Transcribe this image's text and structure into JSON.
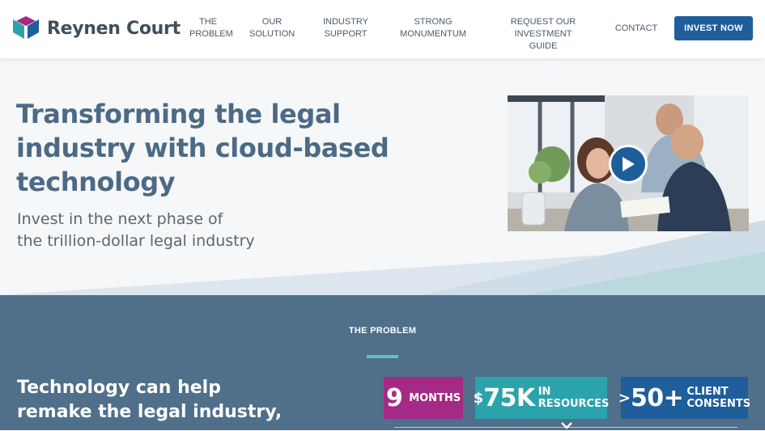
{
  "brand": {
    "name": "Reynen Court"
  },
  "nav": {
    "items": [
      {
        "line1": "The",
        "line2": "Problem"
      },
      {
        "line1": "Our",
        "line2": "Solution"
      },
      {
        "line1": "Industry",
        "line2": "Support"
      },
      {
        "line1": "Strong",
        "line2": "Monumentum"
      },
      {
        "line1": "Request our",
        "line2": "Investment guide"
      },
      {
        "line1": "Contact",
        "line2": ""
      }
    ],
    "cta": "INVEST NOW"
  },
  "hero": {
    "title": "Transforming the legal industry with cloud-based technology",
    "subtitle_line1": "Invest in the next phase of",
    "subtitle_line2": "the trillion-dollar legal industry"
  },
  "problem": {
    "label": "THE PROBLEM",
    "heading_line1": "Technology can help",
    "heading_line2": "remake the legal industry,",
    "stats": [
      {
        "value": "9",
        "label": "MONTHS"
      },
      {
        "prefix": "$",
        "value": "75K",
        "label_line1": "IN",
        "label_line2": "RESOURCES"
      },
      {
        "prefix": ">",
        "value": "50+",
        "label_line1": "CLIENT",
        "label_line2": "CONSENTS"
      }
    ]
  },
  "colors": {
    "brand_blue": "#1e5e9a",
    "title_blue": "#4c6a85",
    "section_bg": "#4f6f8a",
    "magenta": "#a52a86",
    "teal": "#2aa3ab"
  }
}
